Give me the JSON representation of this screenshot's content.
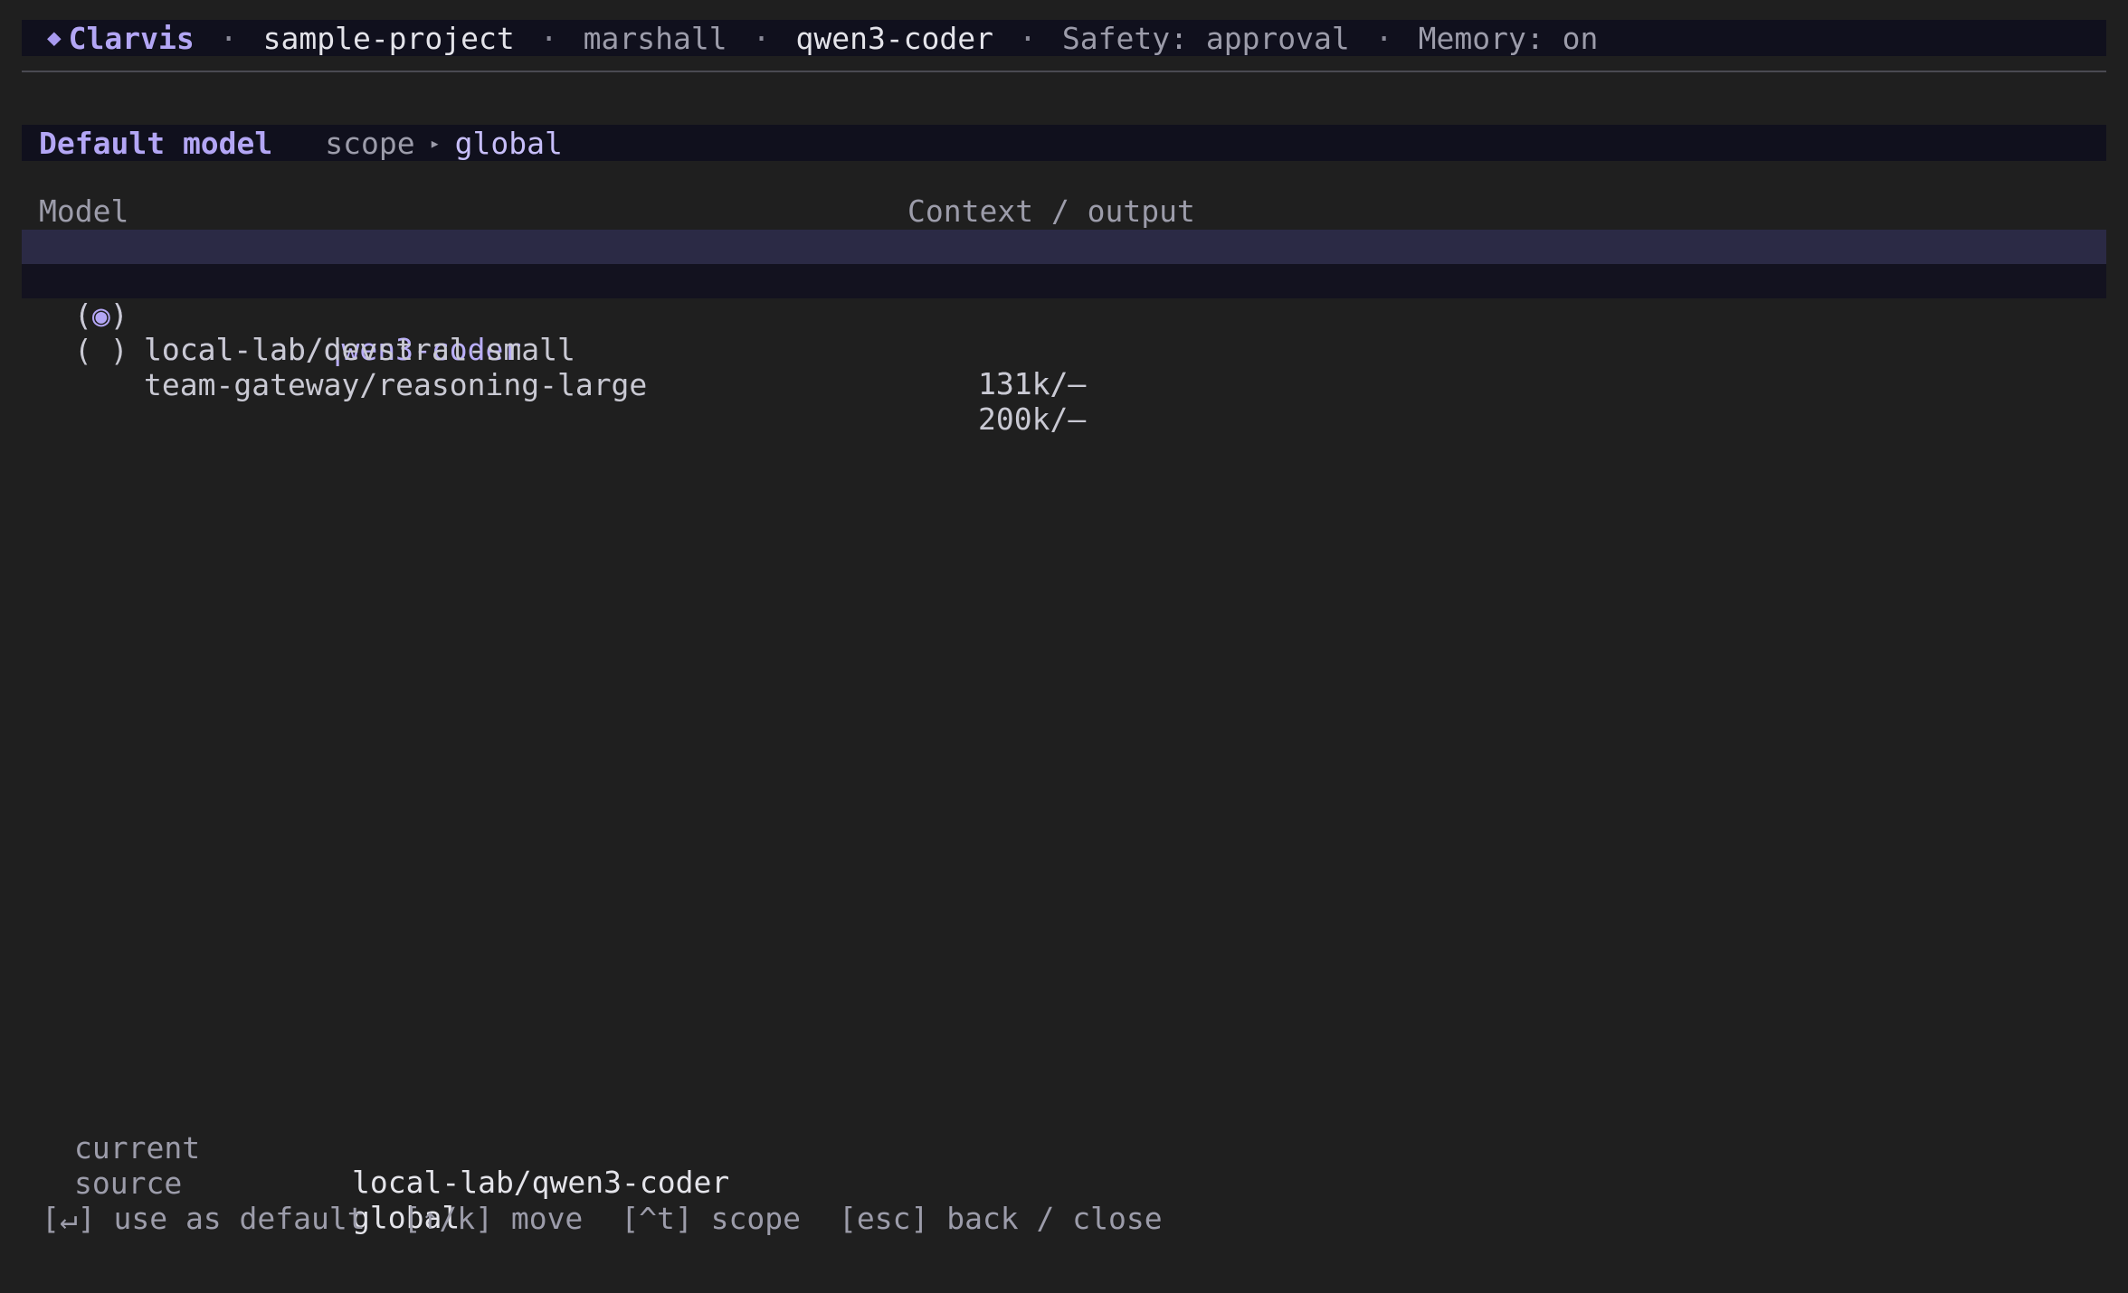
{
  "topbar": {
    "brand_icon": "diamond-icon",
    "brand": "Clarvis",
    "separator": "·",
    "project": "sample-project",
    "user": "marshall",
    "model": "qwen3-coder",
    "safety": "Safety: approval",
    "memory": "Memory: on"
  },
  "header": {
    "title": "Default model",
    "scope_label": "scope",
    "scope_arrow": "▸",
    "scope_value": "global"
  },
  "table": {
    "columns": [
      "Model",
      "Context / output"
    ],
    "cursor_glyph": "▸",
    "rows": [
      {
        "radio": "(◉)",
        "name": "local-lab/qwen3-coder",
        "context": "131k/—",
        "selected": true
      },
      {
        "radio": "( )",
        "name": "local-lab/devstral-small",
        "context": "131k/—",
        "selected": false
      },
      {
        "radio": "( )",
        "name": "team-gateway/reasoning-large",
        "context": "200k/—",
        "selected": false
      }
    ]
  },
  "info": {
    "current_label": "current",
    "current_value": "local-lab/qwen3-coder",
    "source_label": "source",
    "source_value": "global"
  },
  "footer": {
    "hints": [
      "[↵] use as default",
      "[↑/k] move",
      "[^t] scope",
      "[esc] back / close"
    ]
  },
  "colors": {
    "background": "#1f1f1f",
    "bar": "#10101d",
    "accent": "#b3a6f5",
    "selected_row": "#2b2a45"
  }
}
